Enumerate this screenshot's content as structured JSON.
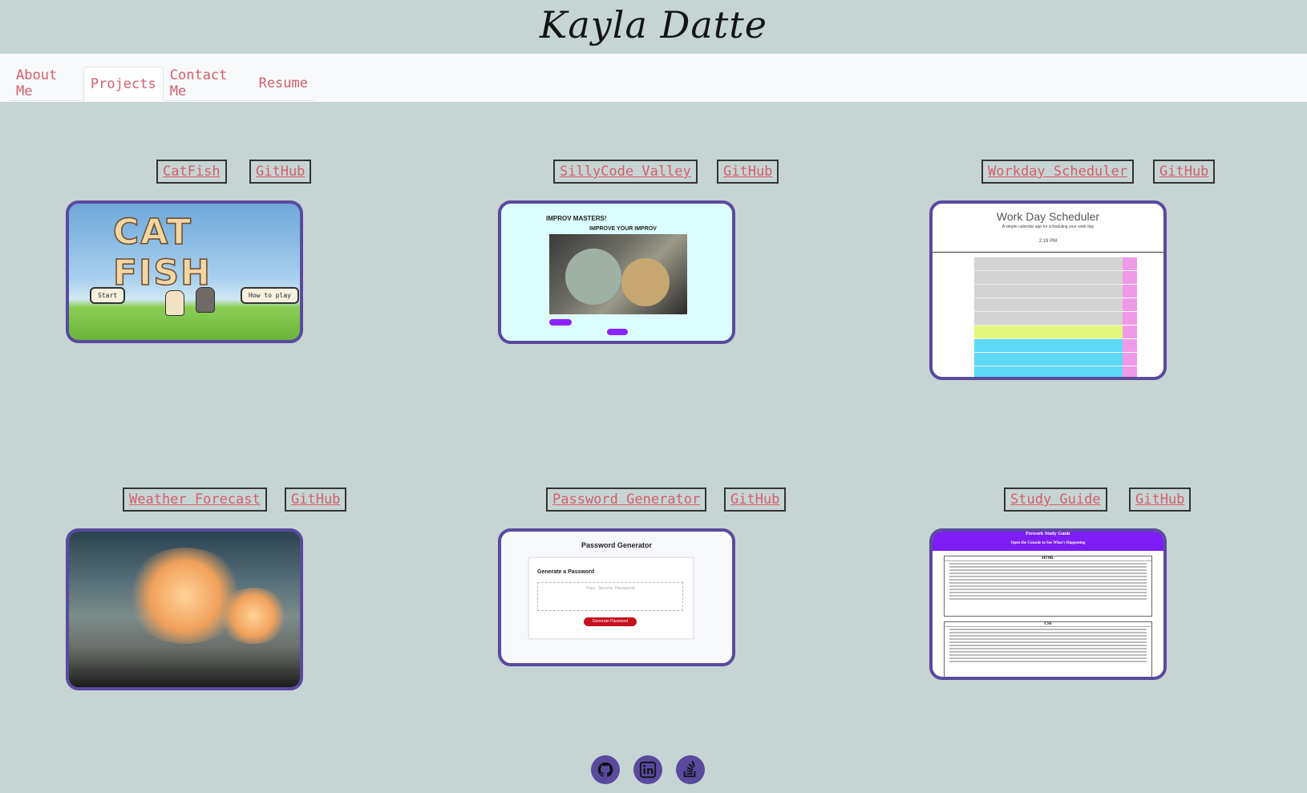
{
  "header": {
    "title": "Kayla Datte"
  },
  "nav": {
    "tabs": [
      {
        "label": "About Me",
        "active": false
      },
      {
        "label": "Projects",
        "active": true
      },
      {
        "label": "Contact Me",
        "active": false
      },
      {
        "label": "Resume",
        "active": false
      }
    ]
  },
  "projects": [
    {
      "name": "CatFish",
      "github": "GitHub",
      "preview": {
        "title": "CAT FISH",
        "buttons": [
          "Start",
          "How to play"
        ]
      }
    },
    {
      "name": "SillyCode Valley",
      "github": "GitHub",
      "preview": {
        "heading": "IMPROV MASTERS!",
        "subheading": "IMPROVE YOUR IMPROV"
      }
    },
    {
      "name": "Workday Scheduler",
      "github": "GitHub",
      "preview": {
        "title": "Work Day Scheduler",
        "subtitle": "A simple calendar app for scheduling your work day",
        "time": "2:19 PM"
      }
    },
    {
      "name": "Weather Forecast",
      "github": "GitHub"
    },
    {
      "name": "Password Generator",
      "github": "GitHub",
      "preview": {
        "title": "Password Generator",
        "subtitle": "Generate a Password",
        "placeholder": "Your Secure Password",
        "button": "Generate Password"
      }
    },
    {
      "name": "Study Guide",
      "github": "GitHub",
      "preview": {
        "title": "Prework Study Guide",
        "banner": "Open the Console to See What's Happening",
        "sections": [
          "HTML",
          "CSS"
        ]
      }
    }
  ],
  "footer": {
    "icons": [
      "github-icon",
      "linkedin-icon",
      "stack-overflow-icon"
    ]
  },
  "colors": {
    "accent": "#d35e6b",
    "border": "#5a4a9e",
    "background": "#c6d5d4"
  }
}
